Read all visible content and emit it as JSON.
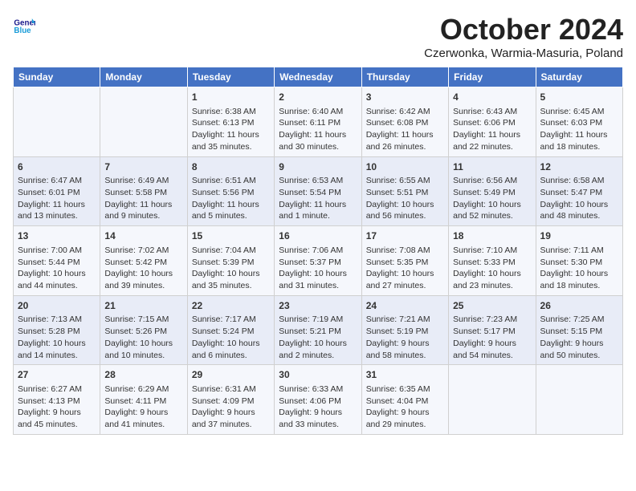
{
  "header": {
    "logo_line1": "General",
    "logo_line2": "Blue",
    "month_title": "October 2024",
    "subtitle": "Czerwonka, Warmia-Masuria, Poland"
  },
  "days_of_week": [
    "Sunday",
    "Monday",
    "Tuesday",
    "Wednesday",
    "Thursday",
    "Friday",
    "Saturday"
  ],
  "weeks": [
    [
      {
        "day": "",
        "content": ""
      },
      {
        "day": "",
        "content": ""
      },
      {
        "day": "1",
        "content": "Sunrise: 6:38 AM\nSunset: 6:13 PM\nDaylight: 11 hours and 35 minutes."
      },
      {
        "day": "2",
        "content": "Sunrise: 6:40 AM\nSunset: 6:11 PM\nDaylight: 11 hours and 30 minutes."
      },
      {
        "day": "3",
        "content": "Sunrise: 6:42 AM\nSunset: 6:08 PM\nDaylight: 11 hours and 26 minutes."
      },
      {
        "day": "4",
        "content": "Sunrise: 6:43 AM\nSunset: 6:06 PM\nDaylight: 11 hours and 22 minutes."
      },
      {
        "day": "5",
        "content": "Sunrise: 6:45 AM\nSunset: 6:03 PM\nDaylight: 11 hours and 18 minutes."
      }
    ],
    [
      {
        "day": "6",
        "content": "Sunrise: 6:47 AM\nSunset: 6:01 PM\nDaylight: 11 hours and 13 minutes."
      },
      {
        "day": "7",
        "content": "Sunrise: 6:49 AM\nSunset: 5:58 PM\nDaylight: 11 hours and 9 minutes."
      },
      {
        "day": "8",
        "content": "Sunrise: 6:51 AM\nSunset: 5:56 PM\nDaylight: 11 hours and 5 minutes."
      },
      {
        "day": "9",
        "content": "Sunrise: 6:53 AM\nSunset: 5:54 PM\nDaylight: 11 hours and 1 minute."
      },
      {
        "day": "10",
        "content": "Sunrise: 6:55 AM\nSunset: 5:51 PM\nDaylight: 10 hours and 56 minutes."
      },
      {
        "day": "11",
        "content": "Sunrise: 6:56 AM\nSunset: 5:49 PM\nDaylight: 10 hours and 52 minutes."
      },
      {
        "day": "12",
        "content": "Sunrise: 6:58 AM\nSunset: 5:47 PM\nDaylight: 10 hours and 48 minutes."
      }
    ],
    [
      {
        "day": "13",
        "content": "Sunrise: 7:00 AM\nSunset: 5:44 PM\nDaylight: 10 hours and 44 minutes."
      },
      {
        "day": "14",
        "content": "Sunrise: 7:02 AM\nSunset: 5:42 PM\nDaylight: 10 hours and 39 minutes."
      },
      {
        "day": "15",
        "content": "Sunrise: 7:04 AM\nSunset: 5:39 PM\nDaylight: 10 hours and 35 minutes."
      },
      {
        "day": "16",
        "content": "Sunrise: 7:06 AM\nSunset: 5:37 PM\nDaylight: 10 hours and 31 minutes."
      },
      {
        "day": "17",
        "content": "Sunrise: 7:08 AM\nSunset: 5:35 PM\nDaylight: 10 hours and 27 minutes."
      },
      {
        "day": "18",
        "content": "Sunrise: 7:10 AM\nSunset: 5:33 PM\nDaylight: 10 hours and 23 minutes."
      },
      {
        "day": "19",
        "content": "Sunrise: 7:11 AM\nSunset: 5:30 PM\nDaylight: 10 hours and 18 minutes."
      }
    ],
    [
      {
        "day": "20",
        "content": "Sunrise: 7:13 AM\nSunset: 5:28 PM\nDaylight: 10 hours and 14 minutes."
      },
      {
        "day": "21",
        "content": "Sunrise: 7:15 AM\nSunset: 5:26 PM\nDaylight: 10 hours and 10 minutes."
      },
      {
        "day": "22",
        "content": "Sunrise: 7:17 AM\nSunset: 5:24 PM\nDaylight: 10 hours and 6 minutes."
      },
      {
        "day": "23",
        "content": "Sunrise: 7:19 AM\nSunset: 5:21 PM\nDaylight: 10 hours and 2 minutes."
      },
      {
        "day": "24",
        "content": "Sunrise: 7:21 AM\nSunset: 5:19 PM\nDaylight: 9 hours and 58 minutes."
      },
      {
        "day": "25",
        "content": "Sunrise: 7:23 AM\nSunset: 5:17 PM\nDaylight: 9 hours and 54 minutes."
      },
      {
        "day": "26",
        "content": "Sunrise: 7:25 AM\nSunset: 5:15 PM\nDaylight: 9 hours and 50 minutes."
      }
    ],
    [
      {
        "day": "27",
        "content": "Sunrise: 6:27 AM\nSunset: 4:13 PM\nDaylight: 9 hours and 45 minutes."
      },
      {
        "day": "28",
        "content": "Sunrise: 6:29 AM\nSunset: 4:11 PM\nDaylight: 9 hours and 41 minutes."
      },
      {
        "day": "29",
        "content": "Sunrise: 6:31 AM\nSunset: 4:09 PM\nDaylight: 9 hours and 37 minutes."
      },
      {
        "day": "30",
        "content": "Sunrise: 6:33 AM\nSunset: 4:06 PM\nDaylight: 9 hours and 33 minutes."
      },
      {
        "day": "31",
        "content": "Sunrise: 6:35 AM\nSunset: 4:04 PM\nDaylight: 9 hours and 29 minutes."
      },
      {
        "day": "",
        "content": ""
      },
      {
        "day": "",
        "content": ""
      }
    ]
  ]
}
